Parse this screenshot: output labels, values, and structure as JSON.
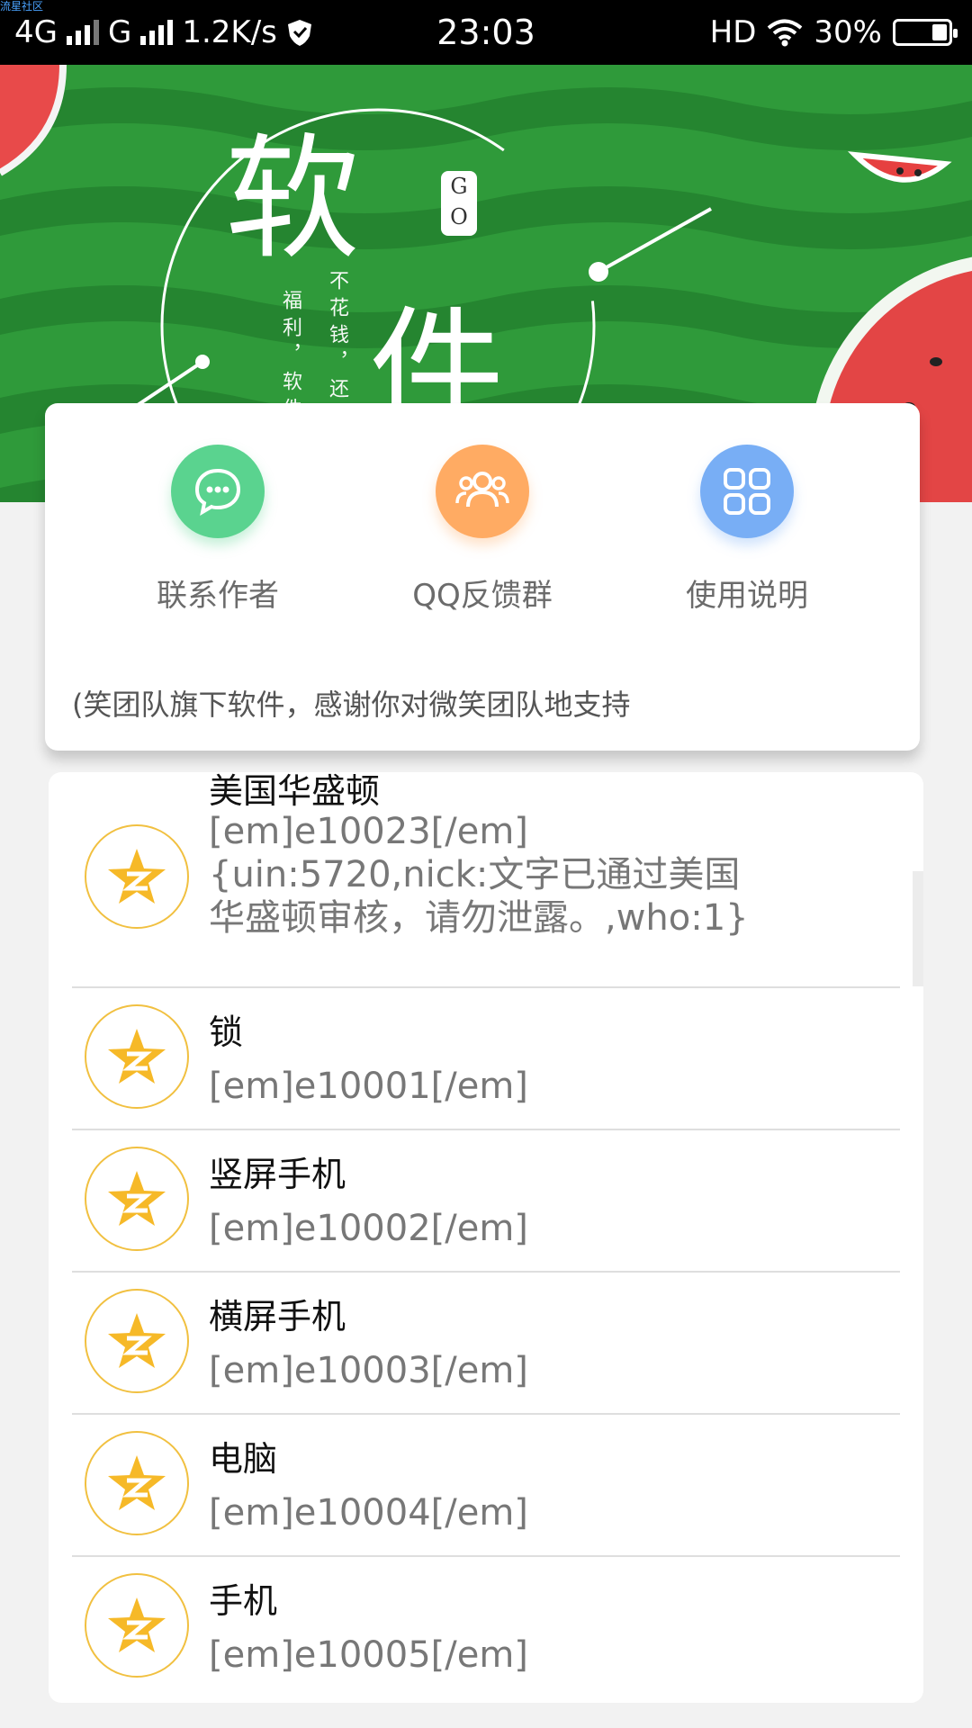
{
  "status_bar": {
    "watermark": "流星社区",
    "net1": "4G",
    "net2": "G",
    "speed": "1.2K/s",
    "time": "23:03",
    "hd": "HD",
    "battery": "30%",
    "battery_level": 0.3
  },
  "banner": {
    "char1": "软",
    "char2": "件",
    "go_tag": "G O",
    "line1": "不花钱，还得",
    "line2": "福利，软件"
  },
  "actions": [
    {
      "label": "联系作者",
      "icon": "chat-icon",
      "color": "#5ad38f"
    },
    {
      "label": "QQ反馈群",
      "icon": "group-icon",
      "color": "#ffab63"
    },
    {
      "label": "使用说明",
      "icon": "grid-icon",
      "color": "#78aef5"
    }
  ],
  "marquee_text": "(笑团队旗下软件，感谢你对微笑团队地支持",
  "list": [
    {
      "name": "美国华盛顿",
      "code": "[em]e10023[/em]{uin:5720,nick:文字已通过美国华盛顿审核，请勿泄露。,who:1}"
    },
    {
      "name": "锁",
      "code": "[em]e10001[/em]"
    },
    {
      "name": "竖屏手机",
      "code": "[em]e10002[/em]"
    },
    {
      "name": "横屏手机",
      "code": "[em]e10003[/em]"
    },
    {
      "name": "电脑",
      "code": "[em]e10004[/em]"
    },
    {
      "name": "手机",
      "code": "[em]e10005[/em]"
    }
  ],
  "colors": {
    "banner_green": "#2f9a3a",
    "avatar_ring": "#f1c040",
    "star": "#f6b928"
  }
}
